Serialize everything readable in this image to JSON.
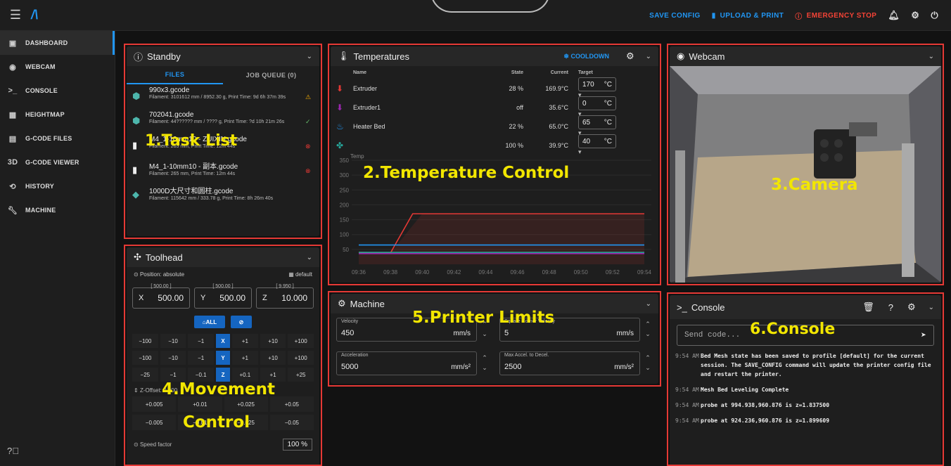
{
  "topbar": {
    "save_config": "SAVE CONFIG",
    "upload_print": "UPLOAD & PRINT",
    "emergency_stop": "EMERGENCY STOP"
  },
  "sidebar": {
    "items": [
      {
        "label": "DASHBOARD",
        "icon": "dashboard-icon"
      },
      {
        "label": "WEBCAM",
        "icon": "webcam-icon"
      },
      {
        "label": "CONSOLE",
        "icon": "console-icon"
      },
      {
        "label": "HEIGHTMAP",
        "icon": "heightmap-icon"
      },
      {
        "label": "G-CODE FILES",
        "icon": "file-icon"
      },
      {
        "label": "G-CODE VIEWER",
        "icon": "3d-icon"
      },
      {
        "label": "HISTORY",
        "icon": "history-icon"
      },
      {
        "label": "MACHINE",
        "icon": "wrench-icon"
      }
    ]
  },
  "standby": {
    "title": "Standby",
    "tab_files": "FILES",
    "tab_queue": "JOB QUEUE (0)",
    "files": [
      {
        "name": "990x3.gcode",
        "meta": "Filament: 3101612 mm / 8952.30 g, Print Time: 9d 6h 37m 39s",
        "status": "warning"
      },
      {
        "name": "702041.gcode",
        "meta": "Filament: 44?????? mm / ???? g, Print Time: ?d 10h 21m 26s",
        "status": "success"
      },
      {
        "name": "M4_1-10mm10 - ZUIXIN.gcode",
        "meta": "Filament: 265 mm, Print Time: 12m 44s",
        "status": "error"
      },
      {
        "name": "M4_1-10mm10 - 副本.gcode",
        "meta": "Filament: 265 mm, Print Time: 12m 44s",
        "status": "error"
      },
      {
        "name": "1000D大尺寸和圆柱.gcode",
        "meta": "Filament: 115642 mm / 333.78 g, Print Time: 8h 26m 40s",
        "status": ""
      }
    ],
    "overlay": "1.Task List"
  },
  "temperatures": {
    "title": "Temperatures",
    "cooldown": "COOLDOWN",
    "headers": {
      "name": "Name",
      "state": "State",
      "current": "Current",
      "target": "Target"
    },
    "rows": [
      {
        "name": "Extruder",
        "state": "28 %",
        "current": "169.9°C",
        "target": "170",
        "unit": "°C"
      },
      {
        "name": "Extruder1",
        "state": "off",
        "current": "35.6°C",
        "target": "0",
        "unit": "°C"
      },
      {
        "name": "Heater Bed",
        "state": "22 %",
        "current": "65.0°C",
        "target": "65",
        "unit": "°C"
      },
      {
        "name": "",
        "state": "100 %",
        "current": "39.9°C",
        "target": "40",
        "unit": "°C"
      }
    ],
    "chart_label": "Temp",
    "overlay": "2.Temperature Control"
  },
  "chart_data": {
    "type": "line",
    "x": [
      "09:36",
      "09:38",
      "09:40",
      "09:42",
      "09:44",
      "09:46",
      "09:48",
      "09:50",
      "09:52",
      "09:54"
    ],
    "ylim": [
      0,
      350
    ],
    "yticks": [
      50,
      100,
      150,
      200,
      250,
      300,
      350
    ],
    "series": [
      {
        "color": "#e53935",
        "values": [
          40,
          38,
          170,
          170,
          170,
          170,
          170,
          170,
          170,
          170
        ]
      },
      {
        "color": "#2196f3",
        "values": [
          65,
          65,
          65,
          65,
          65,
          65,
          65,
          65,
          65,
          65
        ]
      },
      {
        "color": "#26a69a",
        "values": [
          40,
          40,
          40,
          40,
          40,
          40,
          40,
          40,
          40,
          40
        ]
      },
      {
        "color": "#9c27b0",
        "values": [
          36,
          36,
          36,
          36,
          36,
          36,
          36,
          36,
          36,
          36
        ]
      }
    ]
  },
  "webcam": {
    "title": "Webcam",
    "overlay": "3.Camera"
  },
  "toolhead": {
    "title": "Toolhead",
    "position_mode": "Position: absolute",
    "profile": "default",
    "x": {
      "label": "X",
      "value": "500.00",
      "max": "[ 500.00 ]"
    },
    "y": {
      "label": "Y",
      "value": "500.00",
      "max": "[ 500.00 ]"
    },
    "z": {
      "label": "Z",
      "value": "10.000",
      "max": "[ 9.950 ]"
    },
    "home_all": "ALL",
    "jog_x": [
      "−100",
      "−10",
      "−1",
      "X",
      "+1",
      "+10",
      "+100"
    ],
    "jog_y": [
      "−100",
      "−10",
      "−1",
      "Y",
      "+1",
      "+10",
      "+100"
    ],
    "jog_z": [
      "−25",
      "−1",
      "−0.1",
      "Z",
      "+0.1",
      "+1",
      "+25"
    ],
    "z_offset": "Z-Offset: 0.000",
    "z_up": [
      "+0.005",
      "+0.01",
      "+0.025",
      "+0.05"
    ],
    "z_down": [
      "−0.005",
      "−0.01",
      "−0.025",
      "−0.05"
    ],
    "speed_label": "Speed factor",
    "speed_value": "100",
    "speed_unit": "%",
    "overlay_line1": "4.Movement",
    "overlay_line2": "Control"
  },
  "machine": {
    "title": "Machine",
    "velocity_label": "Velocity",
    "velocity_value": "450",
    "velocity_unit": "mm/s",
    "scv_label": "Square Corner Velocity",
    "scv_value": "5",
    "scv_unit": "mm/s",
    "accel_label": "Acceleration",
    "accel_value": "5000",
    "accel_unit": "mm/s²",
    "decel_label": "Max Accel. to Decel.",
    "decel_value": "2500",
    "decel_unit": "mm/s²",
    "overlay": "5.Printer Limits"
  },
  "console": {
    "title": "Console",
    "placeholder": "Send code...",
    "logs": [
      {
        "time": "9:54 AM",
        "msg": "Bed Mesh state has been saved to profile [default] for the current session. The SAVE_CONFIG command will update the printer config file and restart the printer."
      },
      {
        "time": "9:54 AM",
        "msg": "Mesh Bed Leveling Complete"
      },
      {
        "time": "9:54 AM",
        "msg": "probe at 994.938,960.876 is z=1.837500"
      },
      {
        "time": "9:54 AM",
        "msg": "probe at 924.236,960.876 is z=1.899609"
      }
    ],
    "overlay": "6.Console"
  }
}
